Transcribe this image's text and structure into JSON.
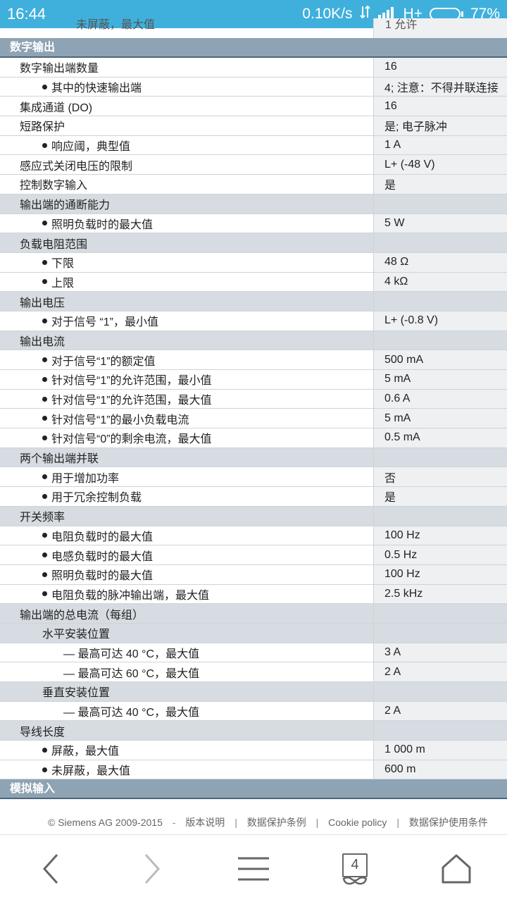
{
  "statusbar": {
    "time": "16:44",
    "network_speed": "0.10K/s",
    "network_type": "H+",
    "battery": "77%",
    "battery_level": 0.77
  },
  "cut_row": {
    "label": "未屏蔽，最大值",
    "value": "1 允许"
  },
  "sections": {
    "digital_output": "数字输出",
    "analog_input": "模拟输入"
  },
  "rows": [
    {
      "type": "row",
      "label": "数字输出端数量",
      "value": "16"
    },
    {
      "type": "sub",
      "label": "其中的快速输出端",
      "value": "4; 注意：不得并联连接"
    },
    {
      "type": "row",
      "label": "集成通道 (DO)",
      "value": "16"
    },
    {
      "type": "row",
      "label": "短路保护",
      "value": "是; 电子脉冲"
    },
    {
      "type": "sub",
      "label": "响应阈，典型值",
      "value": "1 A"
    },
    {
      "type": "row",
      "label": "感应式关闭电压的限制",
      "value": "L+ (-48 V)"
    },
    {
      "type": "row",
      "label": "控制数字输入",
      "value": "是"
    },
    {
      "type": "group",
      "label": "输出端的通断能力",
      "value": ""
    },
    {
      "type": "sub",
      "label": "照明负载时的最大值",
      "value": "5 W"
    },
    {
      "type": "group",
      "label": "负载电阻范围",
      "value": ""
    },
    {
      "type": "sub",
      "label": "下限",
      "value": "48 Ω"
    },
    {
      "type": "sub",
      "label": "上限",
      "value": "4 kΩ"
    },
    {
      "type": "group",
      "label": "输出电压",
      "value": ""
    },
    {
      "type": "sub",
      "label": "对于信号 “1”，最小值",
      "value": "L+ (-0.8 V)"
    },
    {
      "type": "group",
      "label": "输出电流",
      "value": ""
    },
    {
      "type": "sub",
      "label": "对于信号“1”的额定值",
      "value": "500 mA"
    },
    {
      "type": "sub",
      "label": "针对信号“1”的允许范围，最小值",
      "value": "5 mA"
    },
    {
      "type": "sub",
      "label": "针对信号“1”的允许范围，最大值",
      "value": "0.6 A"
    },
    {
      "type": "sub",
      "label": "针对信号“1”的最小负载电流",
      "value": "5 mA"
    },
    {
      "type": "sub",
      "label": "针对信号“0”的剩余电流，最大值",
      "value": "0.5 mA"
    },
    {
      "type": "group",
      "label": "两个输出端并联",
      "value": ""
    },
    {
      "type": "sub",
      "label": "用于增加功率",
      "value": "否"
    },
    {
      "type": "sub",
      "label": "用于冗余控制负载",
      "value": "是"
    },
    {
      "type": "group",
      "label": "开关频率",
      "value": ""
    },
    {
      "type": "sub",
      "label": "电阻负载时的最大值",
      "value": "100 Hz"
    },
    {
      "type": "sub",
      "label": "电感负载时的最大值",
      "value": "0.5 Hz"
    },
    {
      "type": "sub",
      "label": "照明负载时的最大值",
      "value": "100 Hz"
    },
    {
      "type": "sub",
      "label": "电阻负载的脉冲输出端，最大值",
      "value": "2.5 kHz"
    },
    {
      "type": "group",
      "label": "输出端的总电流（每组）",
      "value": ""
    },
    {
      "type": "subgroup",
      "label": "水平安装位置",
      "value": ""
    },
    {
      "type": "sub2",
      "label": "— 最高可达 40 °C，最大值",
      "value": "3 A"
    },
    {
      "type": "sub2",
      "label": "— 最高可达 60 °C，最大值",
      "value": "2 A"
    },
    {
      "type": "subgroup",
      "label": "垂直安装位置",
      "value": ""
    },
    {
      "type": "sub2",
      "label": "— 最高可达 40 °C，最大值",
      "value": "2 A"
    },
    {
      "type": "group",
      "label": "导线长度",
      "value": ""
    },
    {
      "type": "sub",
      "label": "屏蔽，最大值",
      "value": "1 000 m"
    },
    {
      "type": "sub",
      "label": "未屏蔽，最大值",
      "value": "600 m"
    }
  ],
  "footer": {
    "copyright": "© Siemens AG 2009-2015",
    "dash": "-",
    "links": [
      "版本说明",
      "数据保护条例",
      "Cookie policy",
      "数据保护使用条件"
    ]
  },
  "navbar": {
    "tab_count": "4"
  }
}
